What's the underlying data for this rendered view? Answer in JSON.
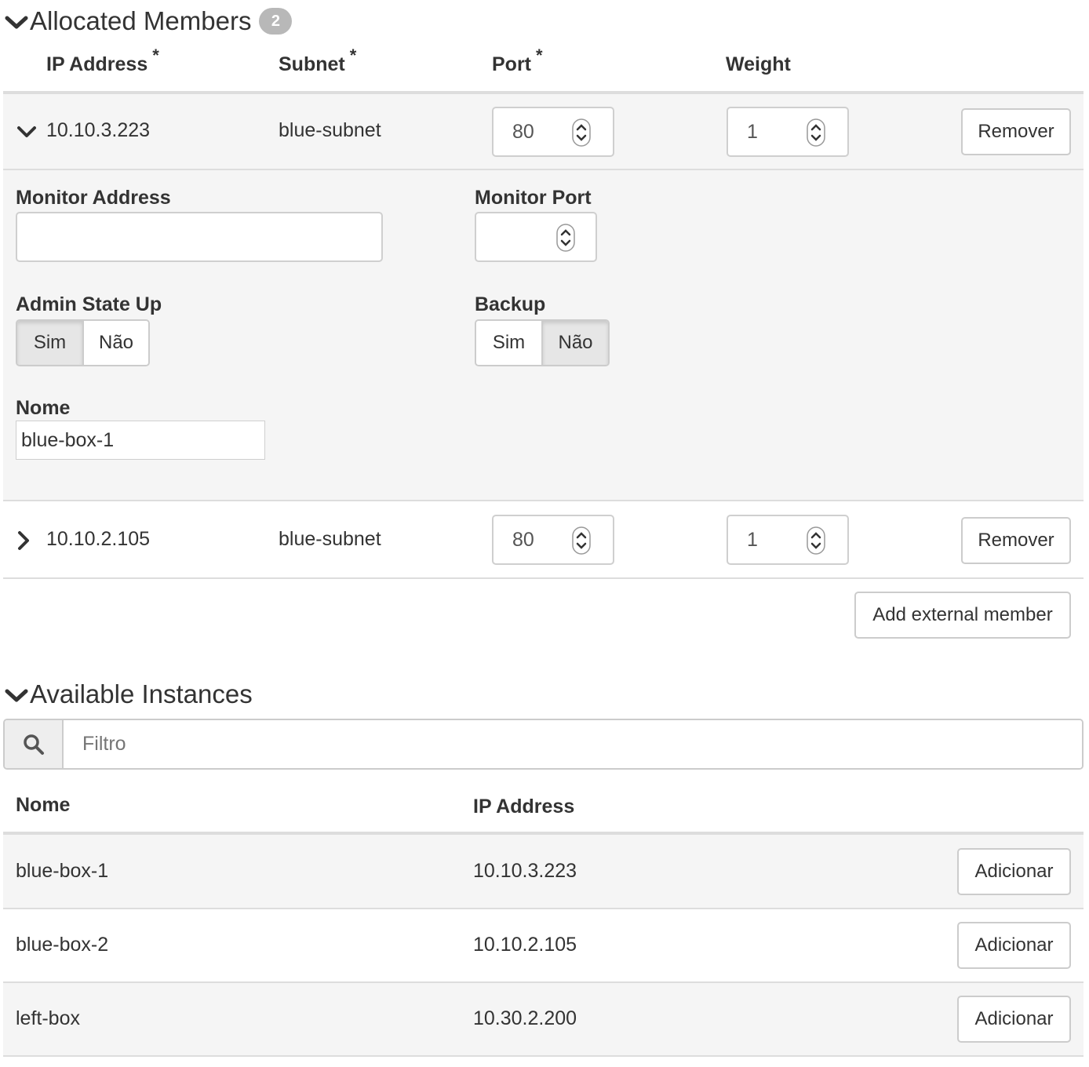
{
  "allocated": {
    "title": "Allocated Members",
    "count": "2",
    "columns": {
      "ip": "IP Address",
      "subnet": "Subnet",
      "port": "Port",
      "weight": "Weight",
      "required_mark": "*"
    },
    "members": [
      {
        "ip": "10.10.3.223",
        "subnet": "blue-subnet",
        "port": "80",
        "weight": "1",
        "remove_label": "Remover",
        "expanded": true
      },
      {
        "ip": "10.10.2.105",
        "subnet": "blue-subnet",
        "port": "80",
        "weight": "1",
        "remove_label": "Remover",
        "expanded": false
      }
    ],
    "details": {
      "monitor_address_label": "Monitor Address",
      "monitor_address_value": "",
      "monitor_port_label": "Monitor Port",
      "monitor_port_value": "",
      "admin_state_label": "Admin State Up",
      "admin_state_options": [
        "Sim",
        "Não"
      ],
      "admin_state_selected": "Sim",
      "backup_label": "Backup",
      "backup_options": [
        "Sim",
        "Não"
      ],
      "backup_selected": "Não",
      "name_label": "Nome",
      "name_value": "blue-box-1"
    },
    "add_external_label": "Add external member"
  },
  "available": {
    "title": "Available Instances",
    "filter_placeholder": "Filtro",
    "columns": {
      "name": "Nome",
      "ip": "IP Address"
    },
    "rows": [
      {
        "name": "blue-box-1",
        "ip": "10.10.3.223",
        "action": "Adicionar"
      },
      {
        "name": "blue-box-2",
        "ip": "10.10.2.105",
        "action": "Adicionar"
      },
      {
        "name": "left-box",
        "ip": "10.30.2.200",
        "action": "Adicionar"
      }
    ]
  },
  "colors": {
    "band": "#f5f5f5",
    "border": "#dddddd",
    "badge": "#b8b8b8"
  }
}
